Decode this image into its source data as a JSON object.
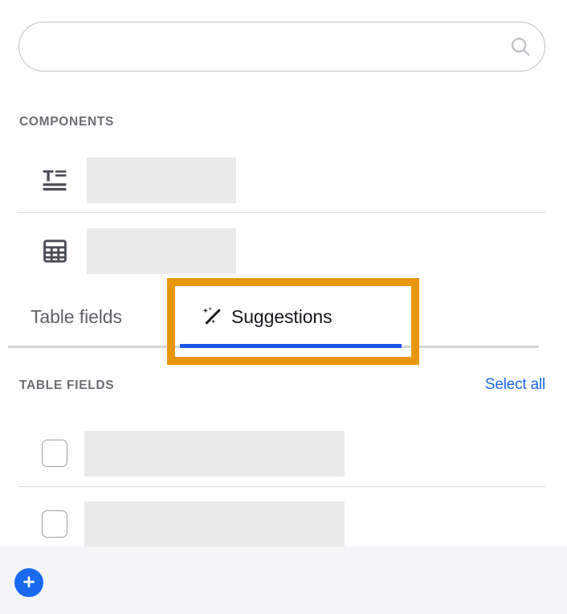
{
  "search": {
    "value": "",
    "placeholder": "",
    "icon": "search-icon"
  },
  "components_section": {
    "label": "COMPONENTS",
    "rows": [
      {
        "icon": "text-format-icon",
        "label": ""
      },
      {
        "icon": "table-grid-icon",
        "label": ""
      }
    ]
  },
  "tabs": [
    {
      "label": "Table fields",
      "active": false,
      "icon": ""
    },
    {
      "label": "Suggestions",
      "active": true,
      "icon": "magic-wand-icon"
    }
  ],
  "table_fields_section": {
    "label": "TABLE FIELDS",
    "select_all_label": "Select all",
    "rows": [
      {
        "checked": false,
        "label": ""
      },
      {
        "checked": false,
        "label": ""
      }
    ]
  },
  "footer": {
    "add_button_label": "+"
  },
  "annotation": {
    "target": "Suggestions",
    "color": "#e8960c"
  },
  "colors": {
    "accent_blue": "#1a6af0",
    "link_blue": "#1a67e8",
    "active_tab_underline": "#1a56e8",
    "annotation_orange": "#e8960c",
    "skeleton_gray": "#eaeaea",
    "divider_gray": "#d8d8d8",
    "muted_text": "#5f6368",
    "footer_bg": "#f4f5f7"
  }
}
